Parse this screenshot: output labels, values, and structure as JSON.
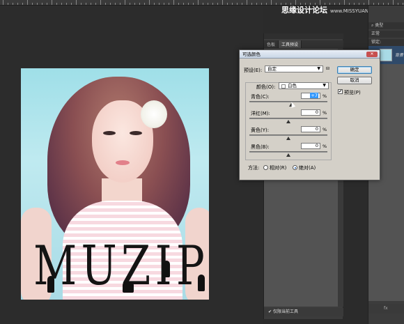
{
  "watermark": {
    "text": "思缘设计论坛",
    "site": "www.MISSYUAN.com"
  },
  "photo": {
    "logo_text": "MUZIPP"
  },
  "panels": {
    "tabs": [
      "色板",
      "工具预设"
    ],
    "footer_checkbox_label": "仅限当前工具",
    "footer_checked": true
  },
  "right_column": {
    "kind_label": "类型",
    "blend_mode": "正常",
    "lock_label": "锁定:",
    "layer_name": "背景",
    "fx_label": "fx"
  },
  "dialog": {
    "title": "可选颜色",
    "preset_label": "预设(E):",
    "preset_value": "自定",
    "colors_label": "颜色(O):",
    "colors_value": "白色",
    "buttons": {
      "ok": "确定",
      "cancel": "取消"
    },
    "preview_label": "预览(P)",
    "preview_checked": true,
    "sliders": [
      {
        "label": "青色(C):",
        "value": "+7",
        "unit": "%",
        "level": 0.535
      },
      {
        "label": "洋红(M):",
        "value": "0",
        "unit": "%",
        "level": 0.5
      },
      {
        "label": "黄色(Y):",
        "value": "0",
        "unit": "%",
        "level": 0.5
      },
      {
        "label": "黑色(B):",
        "value": "0",
        "unit": "%",
        "level": 0.5
      }
    ],
    "method_label": "方法:",
    "method_options": [
      "相对(R)",
      "绝对(A)"
    ],
    "method_selected": "绝对(A)"
  },
  "colors": {
    "dialog_bg": "#d4d0c8",
    "accent": "#3399ff",
    "app_bg": "#2b2b2b"
  }
}
